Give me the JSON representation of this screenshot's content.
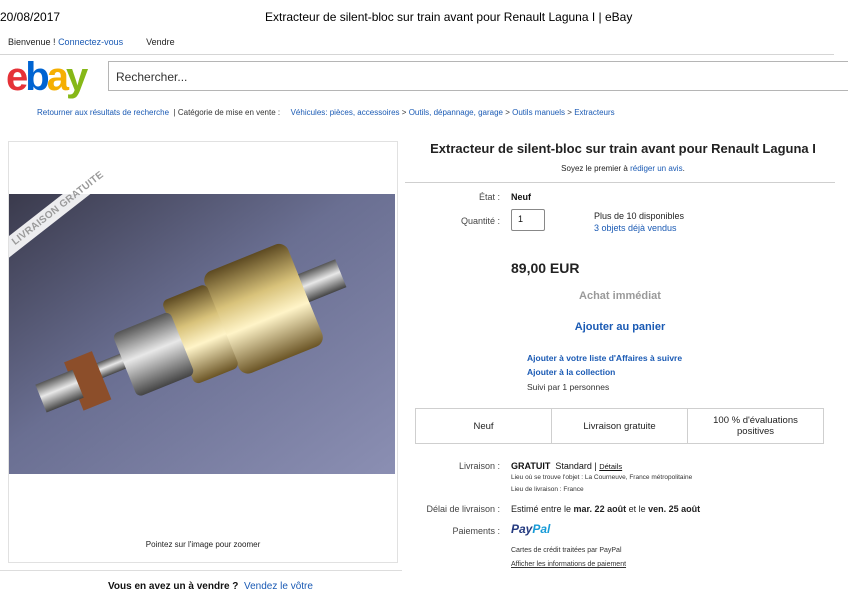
{
  "print_header": {
    "date": "20/08/2017",
    "title": "Extracteur de silent-bloc sur train avant pour Renault Laguna I | eBay"
  },
  "top_nav": {
    "welcome": "Bienvenue !",
    "signin": "Connectez-vous",
    "sell": "Vendre"
  },
  "logo": {
    "e": "e",
    "b": "b",
    "a": "a",
    "y": "y"
  },
  "search": {
    "placeholder": "Rechercher..."
  },
  "breadcrumb": {
    "back": "Retourner aux résultats de recherche",
    "category_label": "Catégorie de mise en vente :",
    "items": [
      "Véhicules: pièces, accessoires",
      "Outils, dépannage, garage",
      "Outils manuels",
      "Extracteurs"
    ],
    "separator": ">"
  },
  "image_panel": {
    "ribbon": "LIVRAISON GRATUITE",
    "zoom_hint": "Pointez sur l'image pour zoomer"
  },
  "sell_prompt": {
    "question": "Vous en avez un à vendre ?",
    "link": "Vendez le vôtre"
  },
  "item": {
    "title": "Extracteur de silent-bloc sur train avant pour Renault Laguna I",
    "review_prefix": "Soyez le premier à",
    "review_link": "rédiger un avis",
    "review_suffix": ".",
    "condition_label": "État :",
    "condition": "Neuf",
    "quantity_label": "Quantité :",
    "quantity": "1",
    "available": "Plus de 10 disponibles",
    "sold": "3 objets déjà vendus",
    "price": "89,00 EUR",
    "buy_now": "Achat immédiat",
    "add_to_cart": "Ajouter au panier",
    "watch": "Ajouter à votre liste d'Affaires à suivre",
    "collection": "Ajouter à la collection",
    "followers": "Suivi par 1 personnes"
  },
  "badges": [
    "Neuf",
    "Livraison gratuite",
    "100 % d'évaluations positives"
  ],
  "shipping": {
    "label": "Livraison :",
    "price": "GRATUIT",
    "service": "Standard",
    "details": "Détails",
    "location": "Lieu où se trouve l'objet : La Courneuve, France métropolitaine",
    "ships_to": "Lieu de livraison : France",
    "delay_label": "Délai de livraison :",
    "delay_prefix": "Estimé entre le",
    "delay_start": "mar. 22 août",
    "delay_mid": "et le",
    "delay_end": "ven. 25 août"
  },
  "payment": {
    "label": "Paiements :",
    "paypal_pay": "Pay",
    "paypal_pal": "Pal",
    "cards": "Cartes de crédit traitées par PayPal",
    "info": "Afficher les informations de paiement"
  },
  "colors": {
    "link": "#1a5ab4",
    "ebay_red": "#e53238",
    "ebay_blue": "#0064d2",
    "ebay_yellow": "#f5af02",
    "ebay_green": "#86b817"
  }
}
